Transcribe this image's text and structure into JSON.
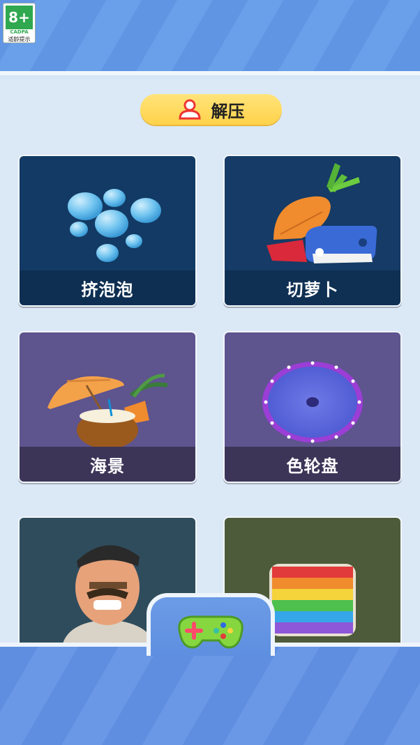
{
  "age_rating": {
    "label": "8+",
    "org": "CADPA",
    "tip": "适龄提示"
  },
  "section": {
    "title": "解压",
    "icon": "user-icon"
  },
  "cards": [
    {
      "label": "挤泡泡",
      "icon": "bubbles-icon",
      "art_color": "#123a64",
      "caption_color": "#0e2f52"
    },
    {
      "label": "切萝卜",
      "icon": "carrot-knife-icon",
      "art_color": "#153b66",
      "caption_color": "#0f3053"
    },
    {
      "label": "海景",
      "icon": "coconut-beach-icon",
      "art_color": "#5e548e",
      "caption_color": "#3d3558"
    },
    {
      "label": "色轮盘",
      "icon": "color-wheel-icon",
      "art_color": "#5e548e",
      "caption_color": "#3d3558"
    },
    {
      "label": "",
      "icon": "angry-man-icon",
      "art_color": "#2f4c5c",
      "caption_color": "#2f4c5c"
    },
    {
      "label": "",
      "icon": "pop-it-icon",
      "art_color": "#4e5b3a",
      "caption_color": "#4e5b3a"
    }
  ],
  "nav": {
    "active_icon": "gamepad-icon"
  }
}
